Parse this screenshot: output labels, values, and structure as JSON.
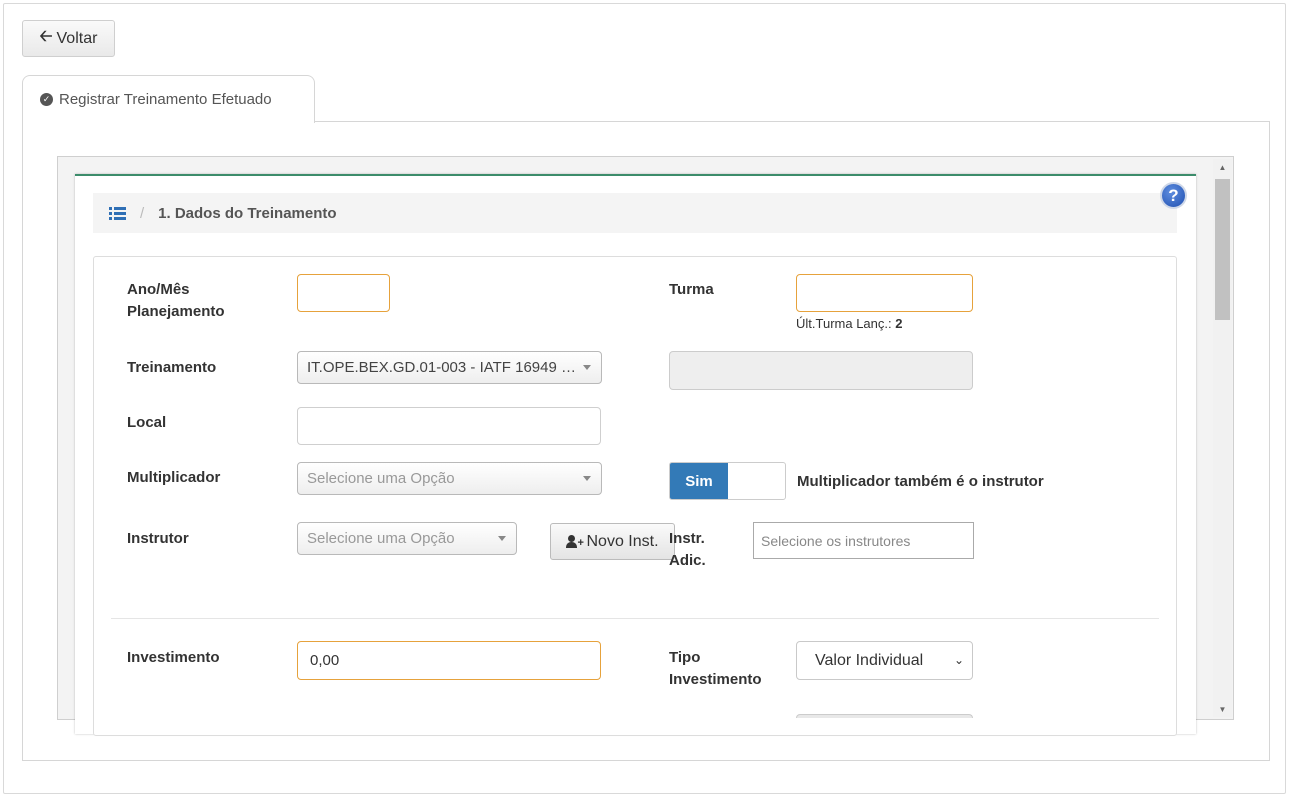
{
  "header": {
    "back_label": "Voltar",
    "tab_label": "Registrar Treinamento Efetuado"
  },
  "section": {
    "title": "1. Dados do Treinamento"
  },
  "form": {
    "ano_mes_label_1": "Ano/Mês",
    "ano_mes_label_2": "Planejamento",
    "ano_mes_value": "",
    "turma_label": "Turma",
    "turma_value": "",
    "ult_turma_label": "Últ.Turma Lanç.:",
    "ult_turma_value": "2",
    "treinamento_label": "Treinamento",
    "treinamento_value": "IT.OPE.BEX.GD.01-003 - IATF 16949 …",
    "treinamento_detail_value": "",
    "local_label": "Local",
    "local_value": "",
    "multiplicador_label": "Multiplicador",
    "multiplicador_placeholder": "Selecione uma Opção",
    "toggle_on_label": "Sim",
    "toggle_text": "Multiplicador também é o instrutor",
    "instrutor_label": "Instrutor",
    "instrutor_placeholder": "Selecione uma Opção",
    "novo_inst_label": "Novo Inst.",
    "instr_adic_label_1": "Instr.",
    "instr_adic_label_2": "Adic.",
    "instr_adic_placeholder": "Selecione os instrutores",
    "investimento_label": "Investimento",
    "investimento_value": "0,00",
    "tipo_inv_label_1": "Tipo",
    "tipo_inv_label_2": "Investimento",
    "tipo_inv_value": "Valor Individual"
  },
  "icons": {
    "back": "arrow-left-icon",
    "tab": "check-circle-icon",
    "breadcrumb": "list-icon",
    "help": "question-circle-icon",
    "new_instructor": "user-plus-icon"
  },
  "colors": {
    "accent_blue": "#337ab7",
    "required_border": "#e6a23c",
    "card_top_border": "#3c8c6b"
  }
}
